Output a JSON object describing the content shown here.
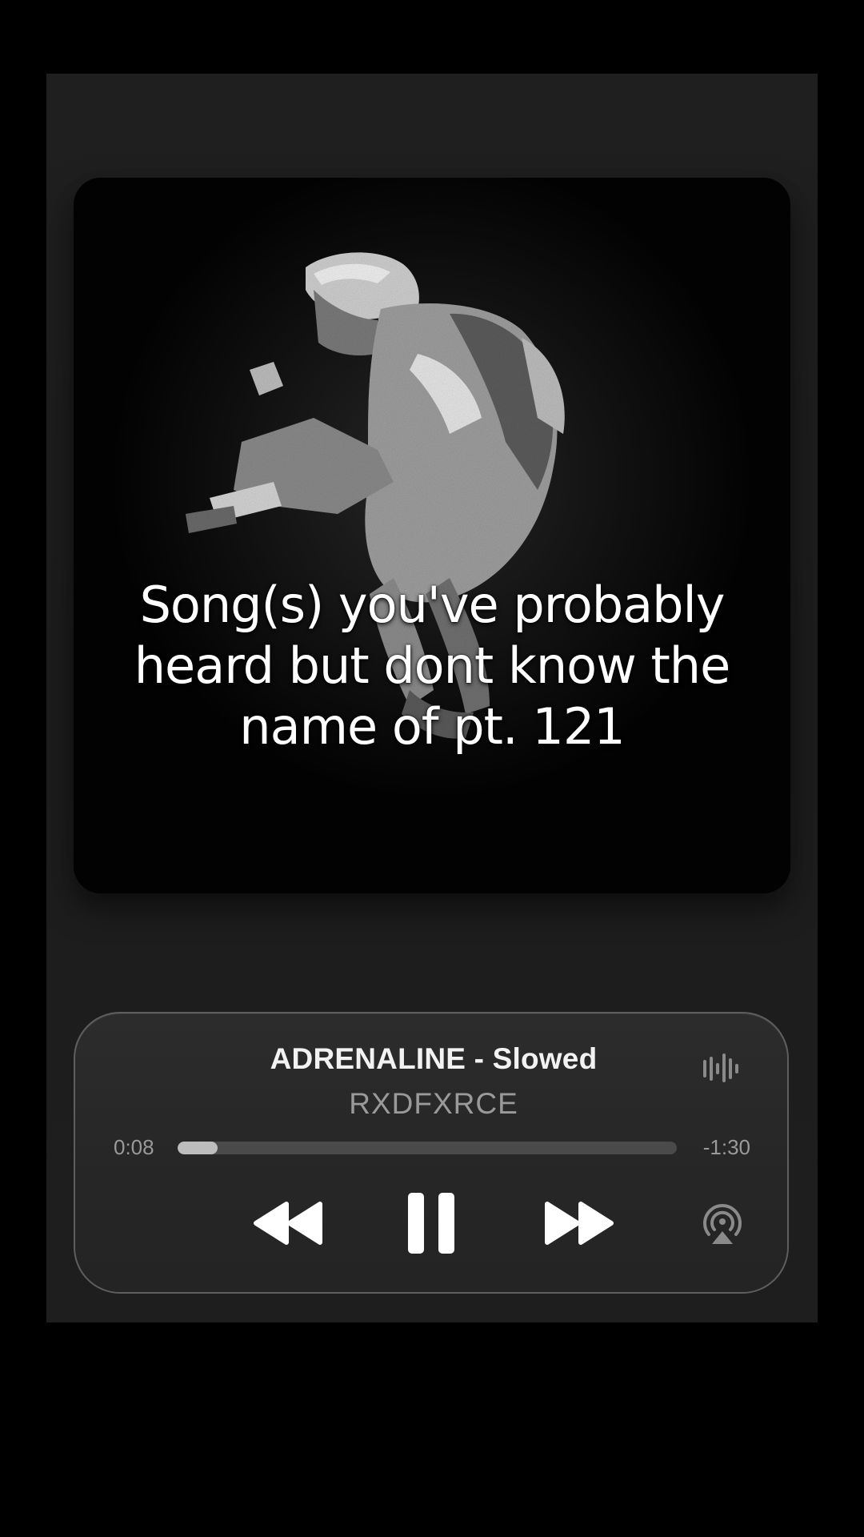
{
  "overlay": {
    "caption_line1": "Song(s) you've probably",
    "caption_line2": "heard but dont know the",
    "caption_line3": "name of pt. 121"
  },
  "player": {
    "title": "ADRENALINE - Slowed",
    "artist": "RXDFXRCE",
    "elapsed": "0:08",
    "remaining": "-1:30",
    "progress_fraction": 0.08,
    "state": "playing",
    "controls": [
      "rewind-icon",
      "pause-icon",
      "fast-forward-icon",
      "airplay-icon"
    ],
    "aux_icon": "waveform-icon"
  },
  "colors": {
    "background": "#000000",
    "panel": "#1e1e1e",
    "player_card": "#282828",
    "title_text": "#f2f2f2",
    "secondary_text": "#9a9a9a",
    "progress_track": "#4a4a4a",
    "progress_fill": "#bdbdbd"
  }
}
